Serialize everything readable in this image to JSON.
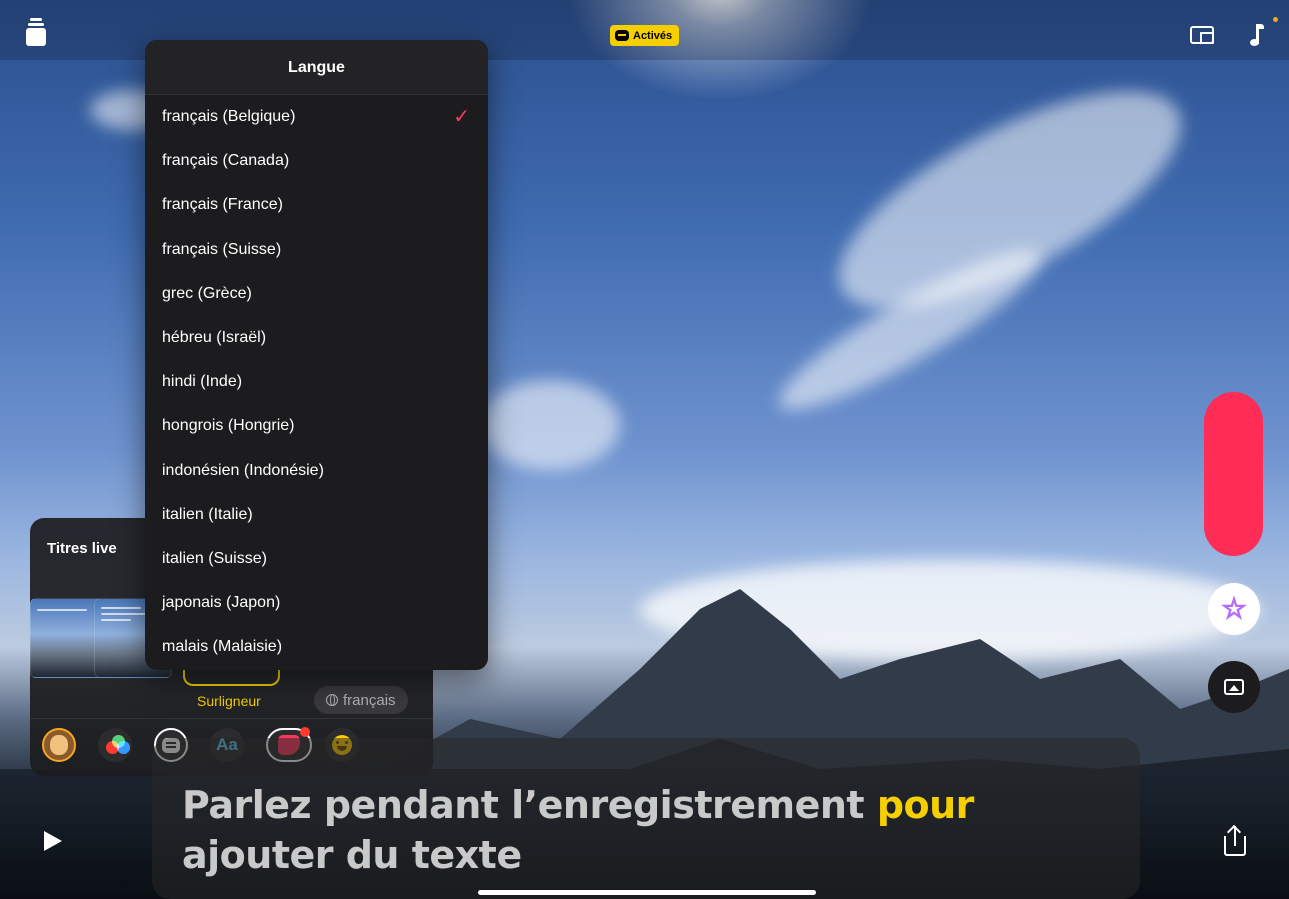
{
  "topbar": {
    "active_badge": "Activés"
  },
  "language_menu": {
    "title": "Langue",
    "selected": "français (Belgique)",
    "items": [
      "français (Belgique)",
      "français (Canada)",
      "français (France)",
      "français (Suisse)",
      "grec (Grèce)",
      "hébreu (Israël)",
      "hindi (Inde)",
      "hongrois (Hongrie)",
      "indonésien (Indonésie)",
      "italien (Italie)",
      "italien (Suisse)",
      "japonais (Japon)",
      "malais (Malaisie)"
    ]
  },
  "live_titles_panel": {
    "title": "Titres live",
    "style_label": "Surligneur",
    "language_pill": "français",
    "tools": [
      "memoji-icon",
      "color-filter-icon",
      "live-captions-icon",
      "text-icon",
      "sticker-icon",
      "emoji-icon"
    ]
  },
  "caption": {
    "text_normal": "Parlez pendant l’enregistrement ",
    "text_highlight": "pour",
    "text_line2": "ajouter du texte"
  },
  "colors": {
    "accent_yellow": "#f5cf00",
    "record_red": "#ff2d55",
    "check_red": "#ff375f",
    "menu_bg": "#1c1c1e"
  }
}
